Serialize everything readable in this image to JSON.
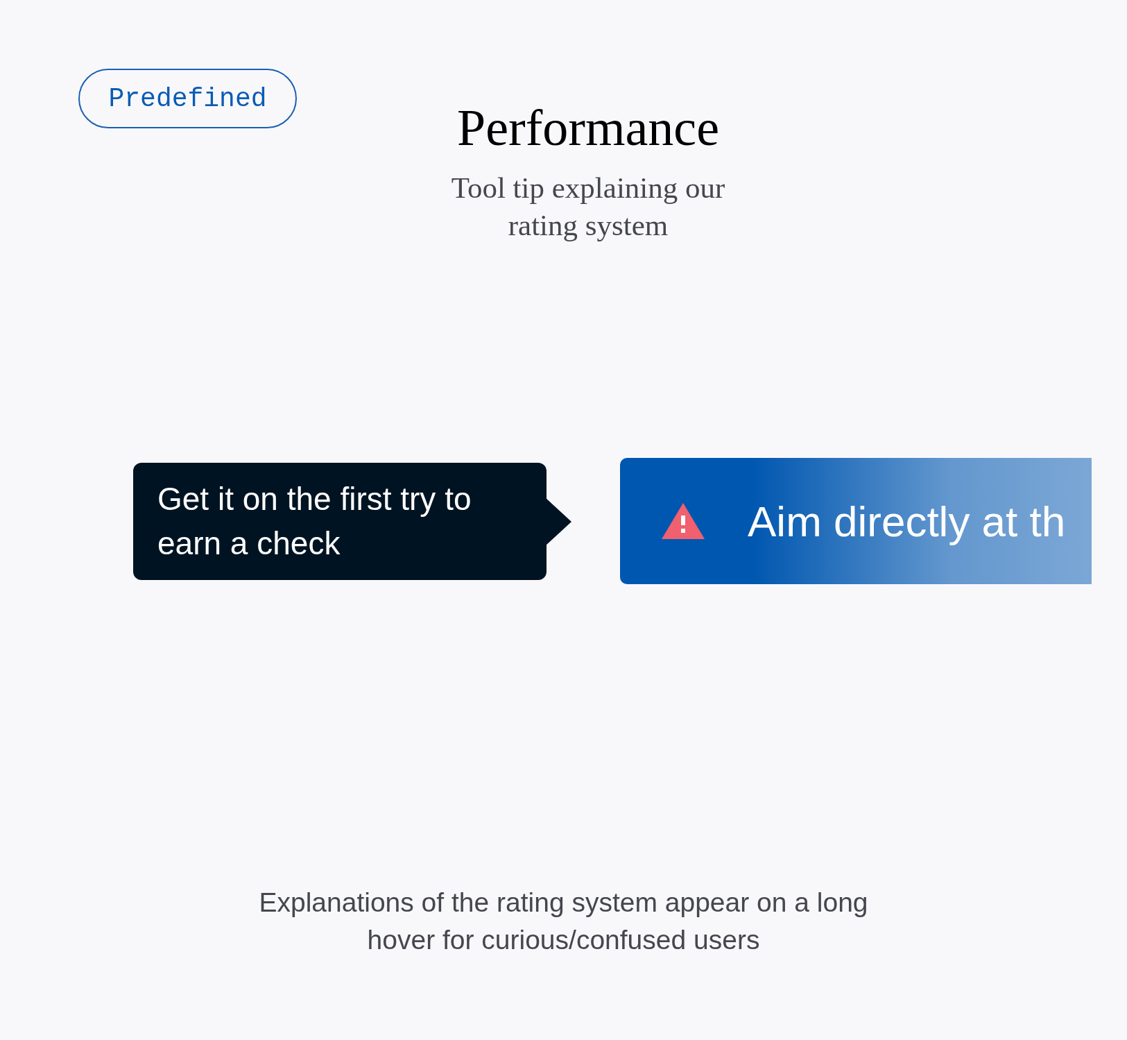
{
  "badge": "Predefined",
  "title": "Performance",
  "subtitle": "Tool tip explaining our rating system",
  "tooltip": {
    "text": "Get it on the first try to earn a check"
  },
  "banner": {
    "text": "Aim directly at th"
  },
  "caption": "Explanations of the rating system appear on a long hover for curious/confused users"
}
